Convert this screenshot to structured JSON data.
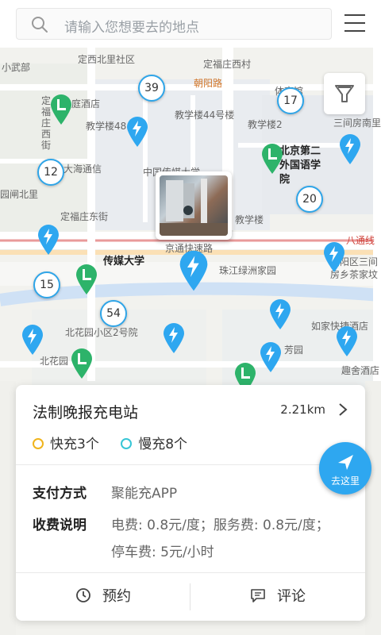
{
  "search": {
    "placeholder": "请输入您想要去的地点"
  },
  "map": {
    "pois": [
      {
        "text": "小武部"
      },
      {
        "text": "定西北里社区"
      },
      {
        "text": "定福庄西村"
      },
      {
        "text": "朝阳路"
      },
      {
        "text": "体育馆"
      },
      {
        "text": "庭酒店"
      },
      {
        "text": "教学楼44号楼"
      },
      {
        "text": "教学楼48"
      },
      {
        "text": "教学楼2"
      },
      {
        "text": "三间房南里"
      },
      {
        "text": "定福庄西街"
      },
      {
        "text": "北京第二外国语学院"
      },
      {
        "text": "大海通信"
      },
      {
        "text": "中国传媒大学"
      },
      {
        "text": "园闸北里"
      },
      {
        "text": "定福庄东街"
      },
      {
        "text": "教学楼"
      },
      {
        "text": "八通线"
      },
      {
        "text": "京通快速路"
      },
      {
        "text": "传媒大学"
      },
      {
        "text": "珠江绿洲家园"
      },
      {
        "text": "朝阳区三间房乡茶家坟"
      },
      {
        "text": "北花园小区2号院"
      },
      {
        "text": "如家快捷酒店"
      },
      {
        "text": "北花园"
      },
      {
        "text": "芳园"
      },
      {
        "text": "趣舍酒店"
      }
    ],
    "clusters": [
      "39",
      "17",
      "12",
      "20",
      "15",
      "54"
    ]
  },
  "station": {
    "name": "法制晚报充电站",
    "distance": "2.21km",
    "fast": "快充3个",
    "slow": "慢充8个",
    "pay_label": "支付方式",
    "pay_value": "聚能充APP",
    "fee_label": "收费说明",
    "fee_line1": "电费: 0.8元/度；服务费: 0.8元/度；",
    "fee_line2": "停车费: 5元/小时",
    "go_label": "去这里",
    "reserve_label": "预约",
    "comment_label": "评论"
  },
  "colors": {
    "accent": "#2ea7f0",
    "fast": "#f0b41c",
    "slow": "#37c6d6",
    "green_pin": "#2db36a",
    "blue_pin": "#2ea7f0"
  }
}
